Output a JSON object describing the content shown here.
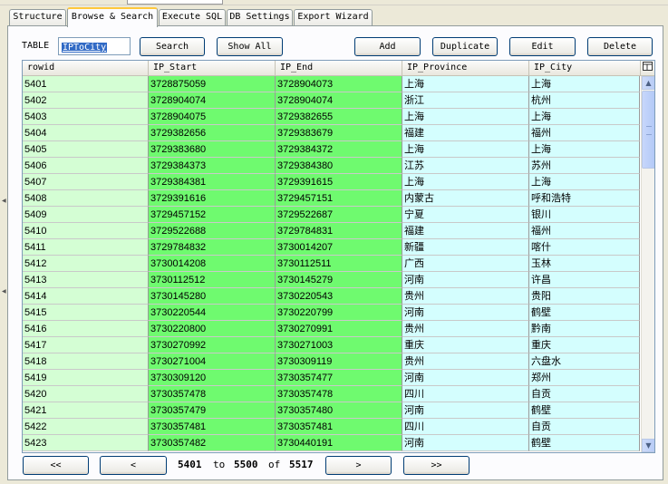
{
  "tabs": [
    {
      "label": "Structure",
      "active": false
    },
    {
      "label": "Browse & Search",
      "active": true
    },
    {
      "label": "Execute SQL",
      "active": false
    },
    {
      "label": "DB Settings",
      "active": false
    },
    {
      "label": "Export Wizard",
      "active": false
    }
  ],
  "toolbar": {
    "table_label": "TABLE",
    "table_value": "IPToCity",
    "search_label": "Search",
    "show_all_label": "Show All",
    "add_label": "Add",
    "duplicate_label": "Duplicate",
    "edit_label": "Edit",
    "delete_label": "Delete"
  },
  "grid": {
    "columns": [
      "rowid",
      "IP_Start",
      "IP_End",
      "IP_Province",
      "IP_City"
    ],
    "rows": [
      [
        "5401",
        "3728875059",
        "3728904073",
        "上海",
        "上海"
      ],
      [
        "5402",
        "3728904074",
        "3728904074",
        "浙江",
        "杭州"
      ],
      [
        "5403",
        "3728904075",
        "3729382655",
        "上海",
        "上海"
      ],
      [
        "5404",
        "3729382656",
        "3729383679",
        "福建",
        "福州"
      ],
      [
        "5405",
        "3729383680",
        "3729384372",
        "上海",
        "上海"
      ],
      [
        "5406",
        "3729384373",
        "3729384380",
        "江苏",
        "苏州"
      ],
      [
        "5407",
        "3729384381",
        "3729391615",
        "上海",
        "上海"
      ],
      [
        "5408",
        "3729391616",
        "3729457151",
        "内蒙古",
        "呼和浩特"
      ],
      [
        "5409",
        "3729457152",
        "3729522687",
        "宁夏",
        "银川"
      ],
      [
        "5410",
        "3729522688",
        "3729784831",
        "福建",
        "福州"
      ],
      [
        "5411",
        "3729784832",
        "3730014207",
        "新疆",
        "喀什"
      ],
      [
        "5412",
        "3730014208",
        "3730112511",
        "广西",
        "玉林"
      ],
      [
        "5413",
        "3730112512",
        "3730145279",
        "河南",
        "许昌"
      ],
      [
        "5414",
        "3730145280",
        "3730220543",
        "贵州",
        "贵阳"
      ],
      [
        "5415",
        "3730220544",
        "3730220799",
        "河南",
        "鹤壁"
      ],
      [
        "5416",
        "3730220800",
        "3730270991",
        "贵州",
        "黔南"
      ],
      [
        "5417",
        "3730270992",
        "3730271003",
        "重庆",
        "重庆"
      ],
      [
        "5418",
        "3730271004",
        "3730309119",
        "贵州",
        "六盘水"
      ],
      [
        "5419",
        "3730309120",
        "3730357477",
        "河南",
        "郑州"
      ],
      [
        "5420",
        "3730357478",
        "3730357478",
        "四川",
        "自贡"
      ],
      [
        "5421",
        "3730357479",
        "3730357480",
        "河南",
        "鹤壁"
      ],
      [
        "5422",
        "3730357481",
        "3730357481",
        "四川",
        "自贡"
      ],
      [
        "5423",
        "3730357482",
        "3730440191",
        "河南",
        "鹤壁"
      ]
    ]
  },
  "pager": {
    "first_label": "<<",
    "prev_label": "<",
    "next_label": ">",
    "last_label": ">>",
    "from": "5401",
    "to_word": "to",
    "to": "5500",
    "of_word": "of",
    "total": "5517"
  },
  "colors": {
    "rowid_bg": "#d4fed4",
    "ip_bg": "#6ffa6f",
    "location_bg": "#d4fefe",
    "active_tab_accent": "#ffc83c"
  },
  "icons": {
    "column_chooser": "grid-columns-icon",
    "scroll_up": "chevron-up-icon",
    "scroll_down": "chevron-down-icon"
  }
}
